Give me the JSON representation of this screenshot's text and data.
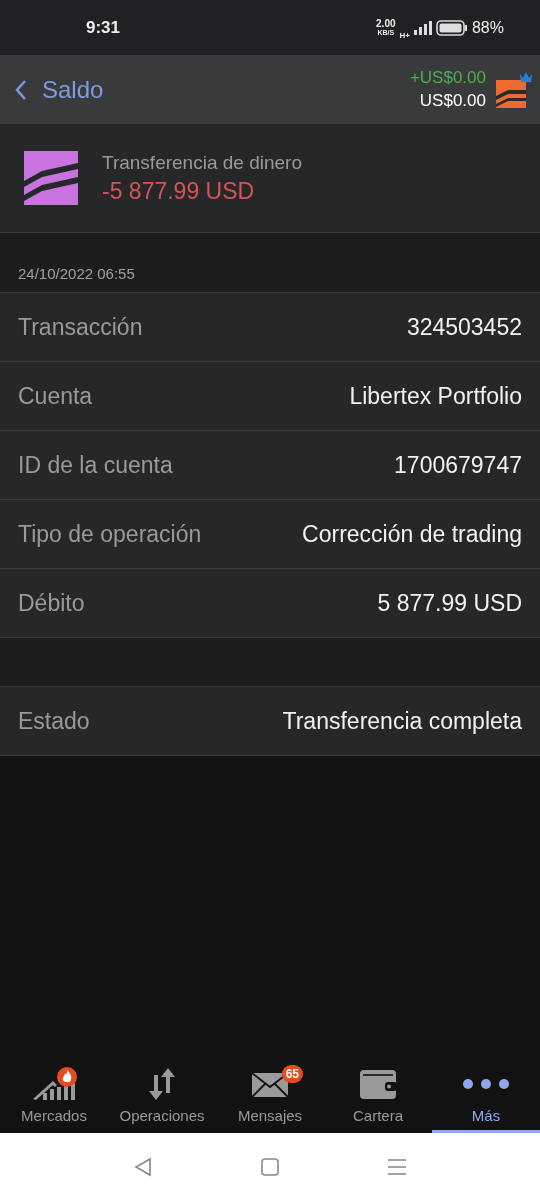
{
  "status_bar": {
    "time": "9:31",
    "speed": "2.00",
    "speed_unit": "KB/S",
    "network": "H+",
    "battery": "88%"
  },
  "header": {
    "back_label": "Saldo",
    "change": "+US$0.00",
    "balance": "US$0.00"
  },
  "transfer": {
    "title": "Transferencia de dinero",
    "amount": "-5 877.99 USD"
  },
  "date": "24/10/2022 06:55",
  "details": [
    {
      "label": "Transacción",
      "value": "324503452"
    },
    {
      "label": "Cuenta",
      "value": "Libertex Portfolio"
    },
    {
      "label": "ID de la cuenta",
      "value": "1700679747"
    },
    {
      "label": "Tipo de operación",
      "value": "Corrección de trading"
    },
    {
      "label": "Débito",
      "value": "5 877.99 USD"
    }
  ],
  "status_row": {
    "label": "Estado",
    "value": "Transferencia completa"
  },
  "tabs": [
    {
      "kind": "markets",
      "label": "Mercados",
      "selected": false
    },
    {
      "kind": "operations",
      "label": "Operaciones",
      "selected": false
    },
    {
      "kind": "messages",
      "label": "Mensajes",
      "badge": "65",
      "selected": false
    },
    {
      "kind": "wallet",
      "label": "Cartera",
      "selected": false
    },
    {
      "kind": "more",
      "label": "Más",
      "selected": true
    }
  ]
}
